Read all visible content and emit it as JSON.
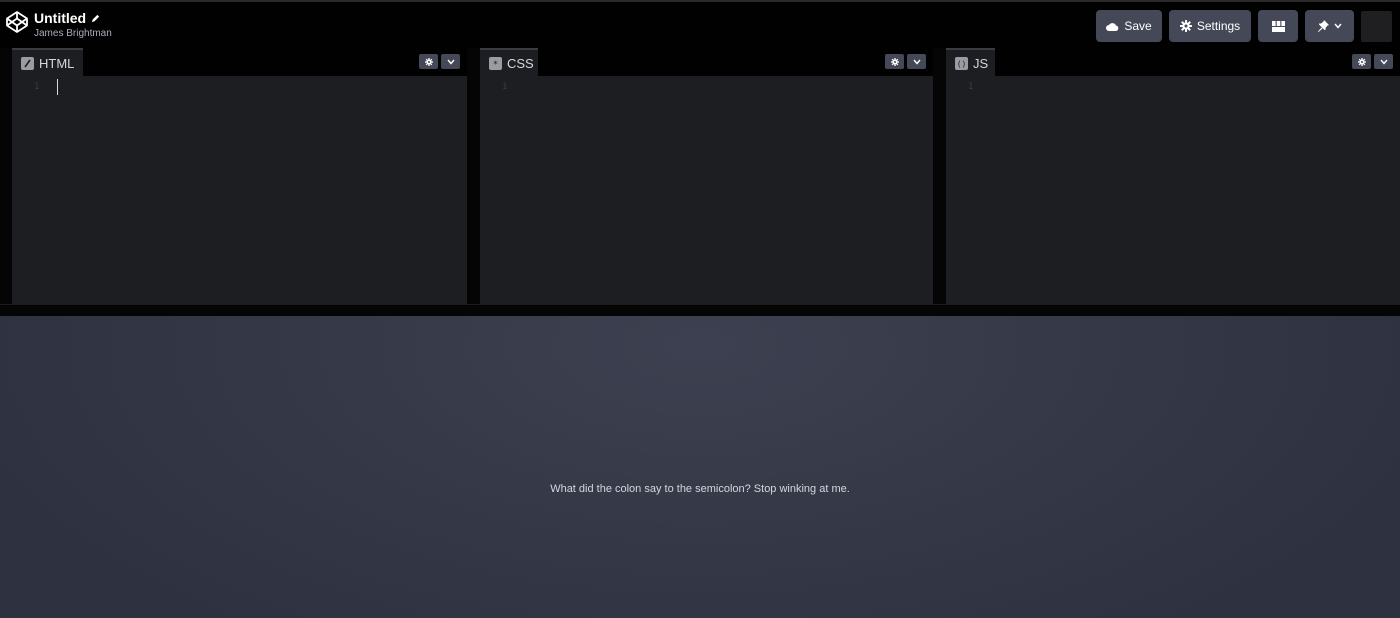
{
  "header": {
    "title": "Untitled",
    "author": "James Brightman",
    "save_label": "Save",
    "settings_label": "Settings",
    "icons": {
      "logo": "codepen-logo-icon",
      "edit": "pencil-icon",
      "save": "cloud-icon",
      "settings": "gear-icon",
      "layout": "layout-icon",
      "pin": "pin-icon",
      "pin_dropdown": "chevron-down-icon"
    }
  },
  "editors": [
    {
      "id": "html",
      "label": "HTML",
      "line_number": "1",
      "icon": "html-icon"
    },
    {
      "id": "css",
      "label": "CSS",
      "line_number": "1",
      "icon": "css-icon"
    },
    {
      "id": "js",
      "label": "JS",
      "line_number": "1",
      "icon": "js-icon"
    }
  ],
  "preview": {
    "text": "What did the colon say to the semicolon? Stop winking at me."
  },
  "colors": {
    "background": "#010101",
    "button": "#444857",
    "editor": "#1d1e22",
    "preview": "#3a3e4c"
  }
}
